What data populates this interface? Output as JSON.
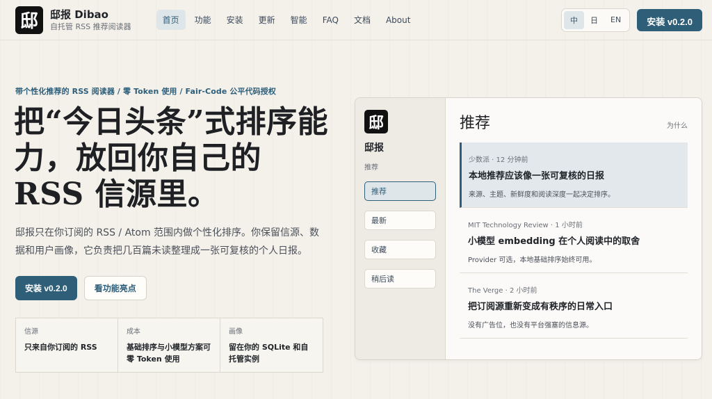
{
  "header": {
    "logo_glyph": "邸",
    "brand_title": "邸报 Dibao",
    "brand_sub": "自托管 RSS 推荐阅读器",
    "nav": [
      {
        "label": "首页",
        "active": true
      },
      {
        "label": "功能"
      },
      {
        "label": "安装"
      },
      {
        "label": "更新"
      },
      {
        "label": "智能"
      },
      {
        "label": "FAQ"
      },
      {
        "label": "文档"
      },
      {
        "label": "About"
      }
    ],
    "languages": [
      {
        "label": "中",
        "active": true
      },
      {
        "label": "日"
      },
      {
        "label": "EN"
      }
    ],
    "install_button": "安装 v0.2.0"
  },
  "hero": {
    "eyebrow": "带个性化推荐的 RSS 阅读器 / 零 Token 使用 / Fair-Code 公平代码授权",
    "title": "把“今日头条”式排序能力，放回你自己的 RSS 信源里。",
    "description": "邸报只在你订阅的 RSS / Atom 范围内做个性化排序。你保留信源、数据和用户画像，它负责把几百篇未读整理成一张可复核的个人日报。",
    "primary_button": "安装 v0.2.0",
    "secondary_button": "看功能亮点"
  },
  "features": [
    {
      "label": "信源",
      "value": "只来自你订阅的 RSS"
    },
    {
      "label": "成本",
      "value": "基础排序与小模型方案可零 Token 使用"
    },
    {
      "label": "画像",
      "value": "留在你的 SQLite 和自托管实例"
    }
  ],
  "preview": {
    "logo_glyph": "邸",
    "app_name": "邸报",
    "app_sub": "推荐",
    "side_nav": [
      {
        "label": "推荐",
        "active": true
      },
      {
        "label": "最新"
      },
      {
        "label": "收藏"
      },
      {
        "label": "稍后读"
      }
    ],
    "title": "推荐",
    "why_link": "为什么",
    "feed": [
      {
        "meta": "少数派 · 12 分钟前",
        "title": "本地推荐应该像一张可复核的日报",
        "desc": "来源、主题、新鲜度和阅读深度一起决定排序。",
        "active": true
      },
      {
        "meta": "MIT Technology Review · 1 小时前",
        "title": "小模型 embedding 在个人阅读中的取舍",
        "desc": "Provider 可选，本地基础排序始终可用。"
      },
      {
        "meta": "The Verge · 2 小时前",
        "title": "把订阅源重新变成有秩序的日常入口",
        "desc": "没有广告位，也没有平台强塞的信息源。"
      }
    ]
  }
}
